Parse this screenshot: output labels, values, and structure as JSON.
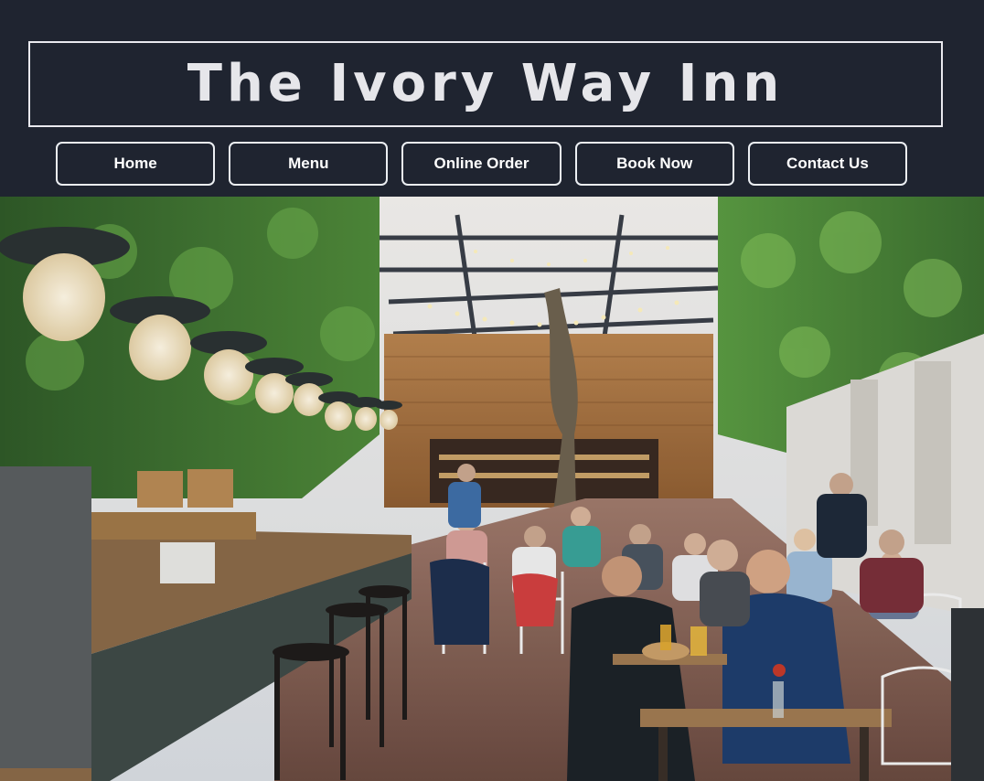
{
  "site": {
    "title": "The Ivory Way Inn"
  },
  "nav": {
    "items": [
      {
        "label": "Home"
      },
      {
        "label": "Menu"
      },
      {
        "label": "Online Order"
      },
      {
        "label": "Book Now"
      },
      {
        "label": "Contact Us"
      }
    ]
  },
  "hero": {
    "icon": "restaurant-courtyard-photo",
    "colors": {
      "background": "#1f2430",
      "button_border": "#eceff3",
      "title_text": "#e6e6ea"
    }
  }
}
